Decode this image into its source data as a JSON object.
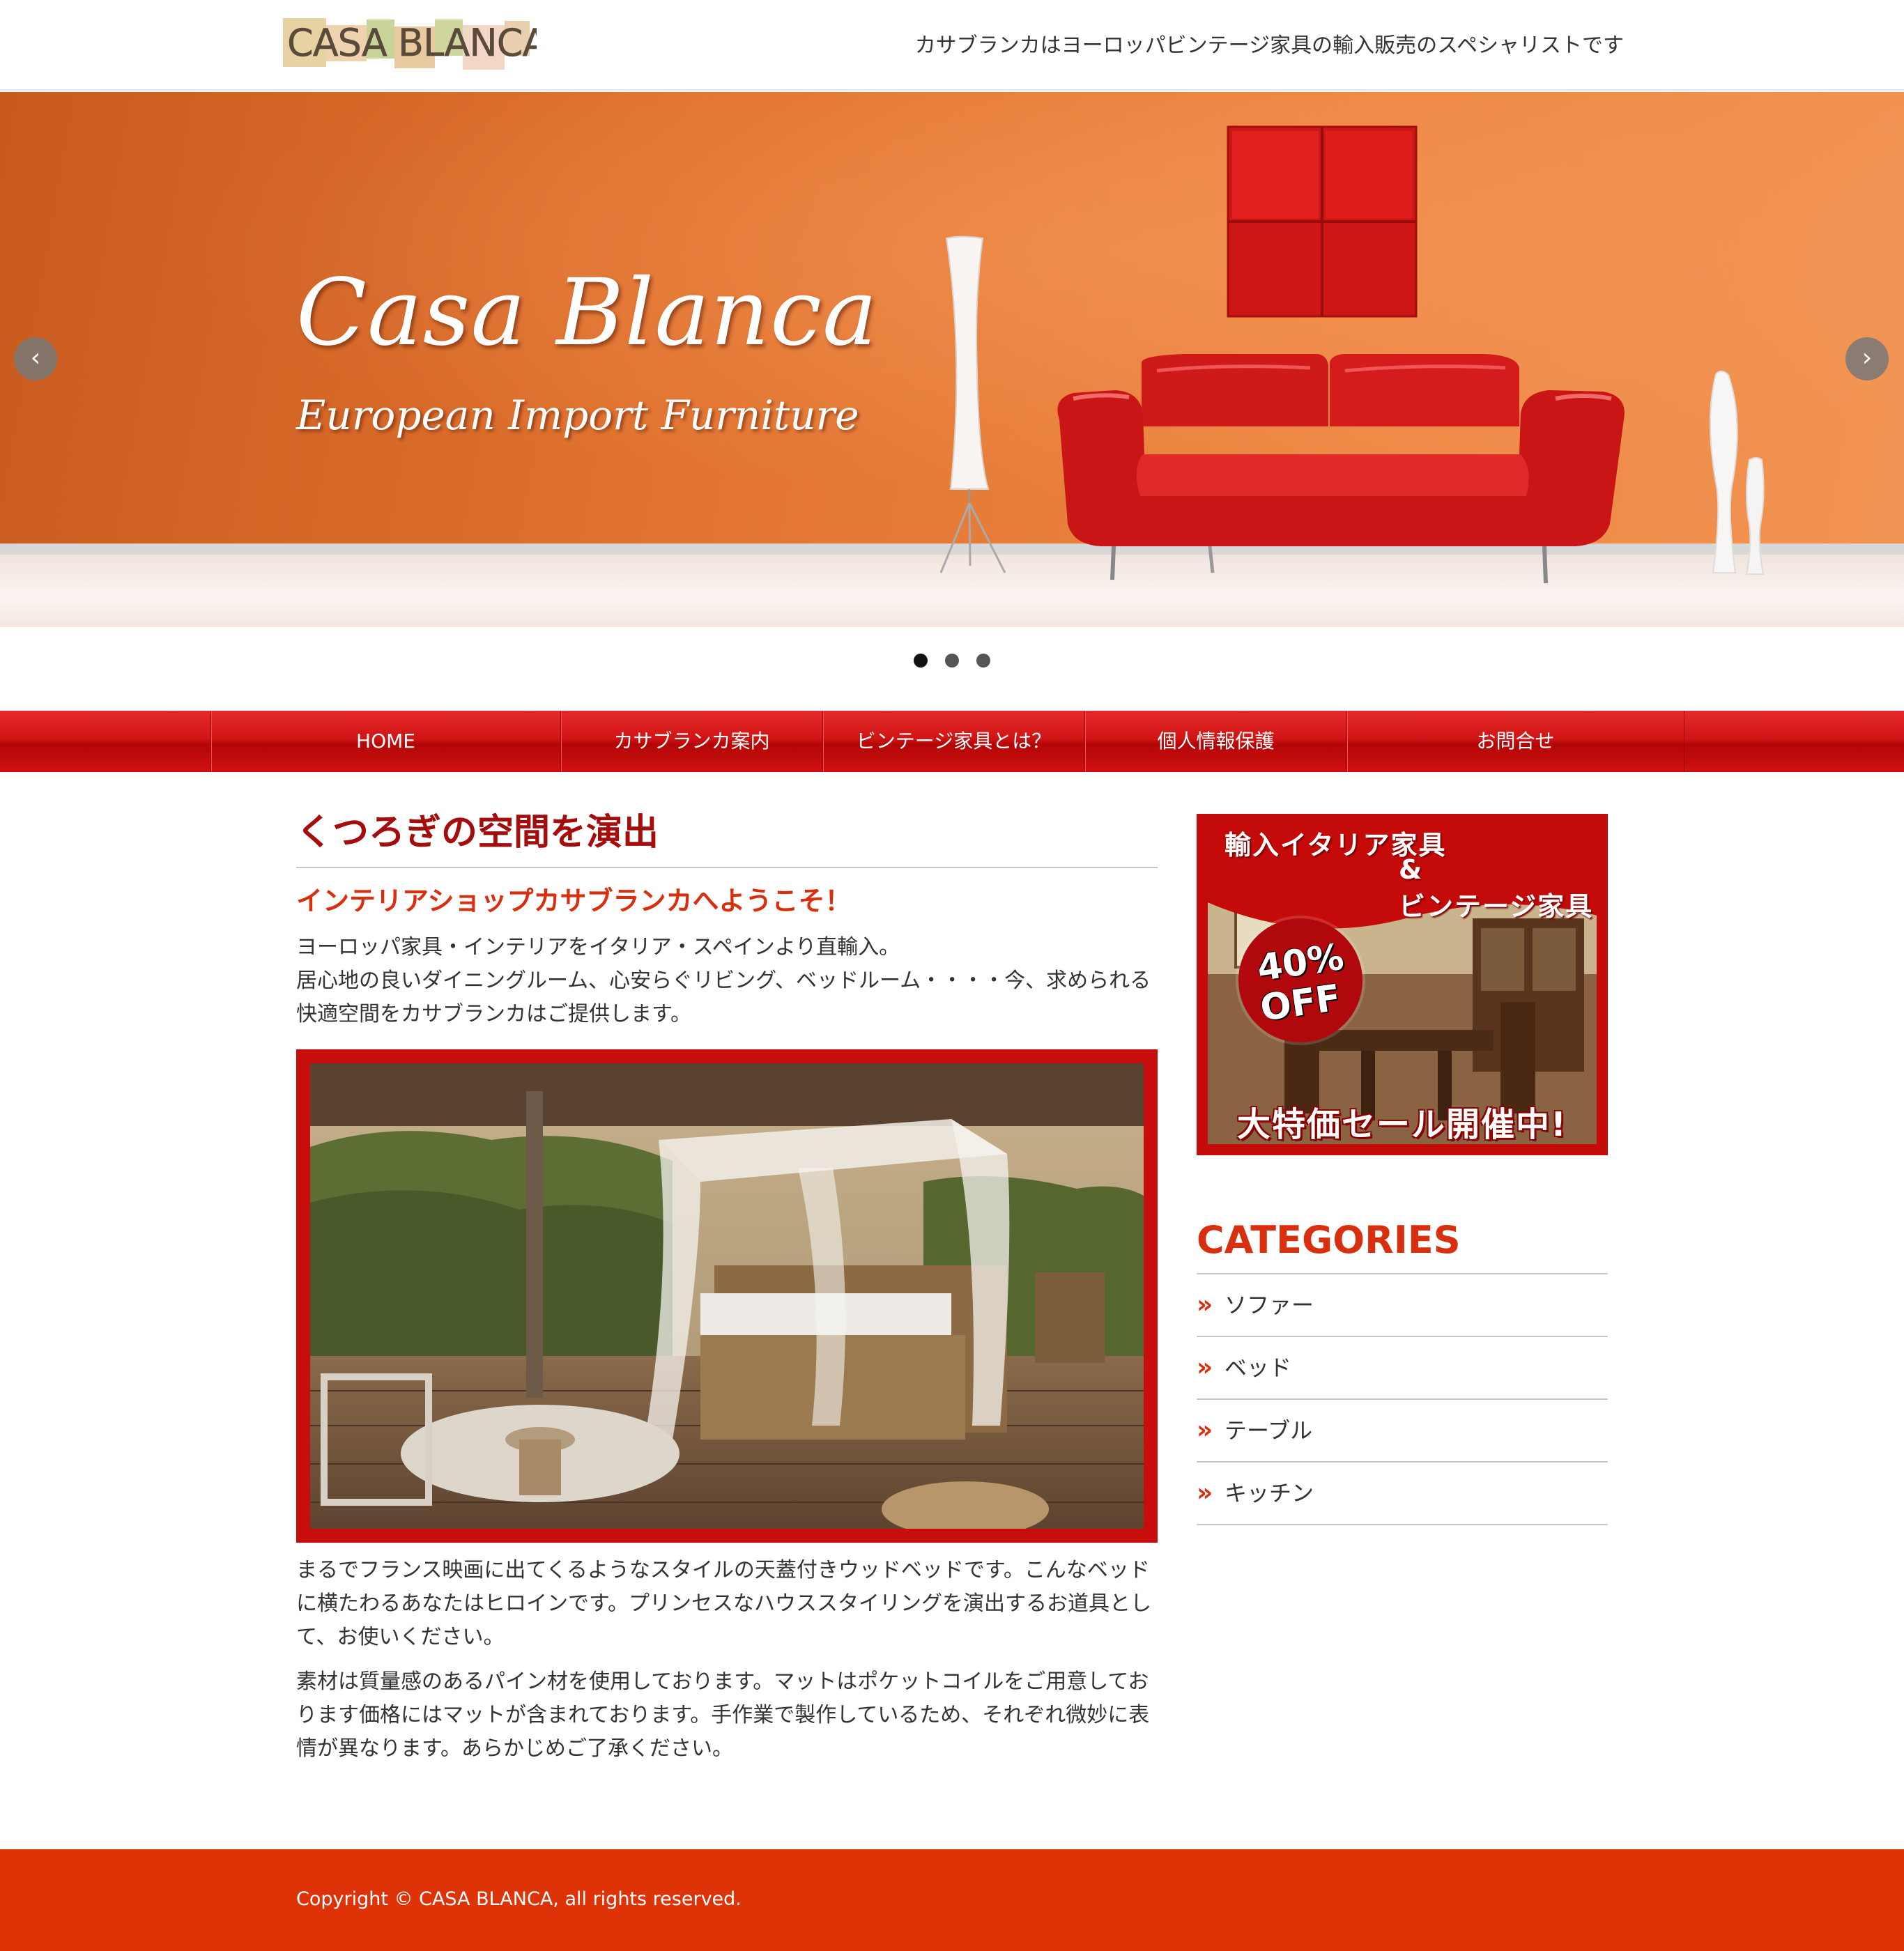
{
  "header": {
    "logo_text": "CASA BLANCA",
    "tagline": "カサブランカはヨーロッパビンテージ家具の輸入販売のスペシャリストです"
  },
  "hero": {
    "title": "Casa Blanca",
    "subtitle": "European Import Furniture",
    "prev_icon": "chevron-left-icon",
    "next_icon": "chevron-right-icon",
    "prev_glyph": "‹",
    "next_glyph": "›",
    "active_slide": 1,
    "slide_count": 3
  },
  "nav": {
    "items": [
      {
        "label": "HOME"
      },
      {
        "label": "カサブランカ案内"
      },
      {
        "label": "ビンテージ家具とは？"
      },
      {
        "label": "個人情報保護"
      },
      {
        "label": "お問合せ"
      }
    ]
  },
  "main": {
    "title": "くつろぎの空間を演出",
    "subhead": "インテリアショップカサブランカへようこそ！",
    "intro_line1": "ヨーロッパ家具・インテリアをイタリア・スペインより直輸入。",
    "intro_line2": "居心地の良いダイニングルーム、心安らぐリビング、ベッドルーム・・・・今、求められる快適空間をカサブランカはご提供します。",
    "para1": "まるでフランス映画に出てくるようなスタイルの天蓋付きウッドベッドです。こんなベッドに横たわるあなたはヒロインです。プリンセスなハウススタイリングを演出するお道具として、お使いください。",
    "para2": "素材は質量感のあるパイン材を使用しております。マットはポケットコイルをご用意しております価格にはマットが含まれております。手作業で製作しているため、それぞれ微妙に表情が異なります。あらかじめご了承ください。"
  },
  "sidebar": {
    "banner": {
      "line1": "輸入イタリア家具",
      "amp": "&",
      "line2": "ビンテージ家具",
      "discount": "40%",
      "off": "OFF",
      "sale": "大特価セール開催中!"
    },
    "categories_title": "CATEGORIES",
    "categories": [
      {
        "label": "ソファー"
      },
      {
        "label": "ベッド"
      },
      {
        "label": "テーブル"
      },
      {
        "label": "キッチン"
      }
    ],
    "arrow_glyph": "»"
  },
  "footer": {
    "copyright": "Copyright © CASA BLANCA, all rights reserved."
  },
  "colors": {
    "accent_red": "#c80d0d",
    "heading_orange": "#d8300f",
    "footer_bg": "#dd3307",
    "title_dark_red": "#a50d0d"
  }
}
